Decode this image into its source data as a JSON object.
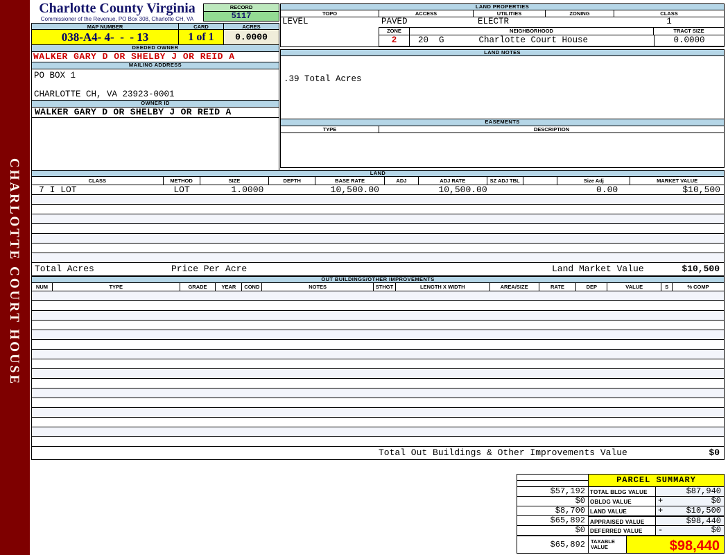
{
  "sidebar": {
    "text": "CHARLOTTE COURT HOUSE"
  },
  "header": {
    "title": "Charlotte County Virginia",
    "subtitle": "Commissioner of the Revenue, PO Box 308, Charlotte CH, VA",
    "record_label": "RECORD",
    "record_value": "5117",
    "map_number_label": "MAP NUMBER",
    "map_number_value": "038-A4- 4-  -  - 13",
    "card_label": "CARD",
    "card_value": "1 of 1",
    "acres_label": "ACRES",
    "acres_value": "0.0000"
  },
  "owner": {
    "deeded_owner_label": "DEEDED OWNER",
    "deeded_owner": "WALKER GARY D OR SHELBY J OR REID A",
    "mailing_address_label": "MAILING ADDRESS",
    "address_line1": "PO BOX 1",
    "address_line2": "CHARLOTTE CH, VA 23923-0001",
    "owner_id_label": "OWNER ID",
    "owner_id": "WALKER GARY D OR SHELBY J OR REID A"
  },
  "land_properties": {
    "title": "LAND PROPERTIES",
    "columns": [
      "TOPO",
      "ACCESS",
      "UTILITIES",
      "ZONING",
      "CLASS"
    ],
    "values": {
      "topo": "LEVEL",
      "access": "PAVED",
      "utilities": "ELECTR",
      "zoning": "",
      "class": "1"
    },
    "zone_label": "ZONE",
    "zone_value": "2",
    "zone_codes": "20  G",
    "neighborhood_label": "NEIGHBORHOOD",
    "neighborhood_value": "Charlotte Court House",
    "tract_size_label": "TRACT SIZE",
    "tract_size_value": "0.0000"
  },
  "land_notes": {
    "title": "LAND NOTES",
    "note": ".39 Total Acres"
  },
  "easements": {
    "title": "EASEMENTS",
    "type_label": "TYPE",
    "description_label": "DESCRIPTION"
  },
  "land_table": {
    "title": "LAND",
    "columns": [
      "CLASS",
      "METHOD",
      "SIZE",
      "DEPTH",
      "BASE RATE",
      "ADJ",
      "ADJ RATE",
      "SZ ADJ TBL",
      "",
      "Size Adj",
      "MARKET VALUE"
    ],
    "row": {
      "class": "7 I LOT",
      "method": "LOT",
      "size": "1.0000",
      "depth": "",
      "base_rate": "10,500.00",
      "adj": "",
      "adj_rate": "10,500.00",
      "sz_adj_tbl": "",
      "size_adj": "0.00",
      "market_value": "$10,500"
    },
    "empty_rows": 7,
    "total_acres_label": "Total Acres",
    "price_per_acre_label": "Price Per Acre",
    "land_market_value_label": "Land Market Value",
    "land_market_value": "$10,500"
  },
  "out_buildings": {
    "title": "OUT BUILDINGS/OTHER IMPROVEMENTS",
    "columns": [
      "NUM",
      "TYPE",
      "GRADE",
      "YEAR",
      "COND",
      "NOTES",
      "STHGT",
      "LENGTH X WIDTH",
      "AREA/SIZE",
      "RATE",
      "DEP",
      "VALUE",
      "S",
      "% COMP"
    ],
    "empty_rows": 16,
    "total_label": "Total Out Buildings & Other Improvements Value",
    "total_value": "$0"
  },
  "parcel_summary": {
    "title": "PARCEL SUMMARY",
    "rows": [
      {
        "prior": "$57,192",
        "label": "TOTAL BLDG VALUE",
        "op": "",
        "value": "$87,940"
      },
      {
        "prior": "$0",
        "label": "OBLDG VALUE",
        "op": "+",
        "value": "$0"
      },
      {
        "prior": "$8,700",
        "label": "LAND VALUE",
        "op": "+",
        "value": "$10,500"
      },
      {
        "prior": "$65,892",
        "label": "APPRAISED VALUE",
        "op": "",
        "value": "$98,440"
      },
      {
        "prior": "$0",
        "label": "DEFERRED VALUE",
        "op": "-",
        "value": "$0"
      }
    ],
    "taxable": {
      "prior": "$65,892",
      "label": "TAXABLE VALUE",
      "value": "$98,440"
    }
  },
  "colors": {
    "maroon": "#7E0000",
    "header_bar_blue": "#B5D6E7",
    "highlight_yellow": "#FFFF00",
    "record_green": "#93DB93",
    "record_green_light": "#BDE8BD",
    "acres_cream": "#F0EDDA",
    "alt_row_blue": "#F3F5FB",
    "owner_red": "#CC0000",
    "taxable_red": "#EE0000",
    "title_navy": "#16166B"
  }
}
